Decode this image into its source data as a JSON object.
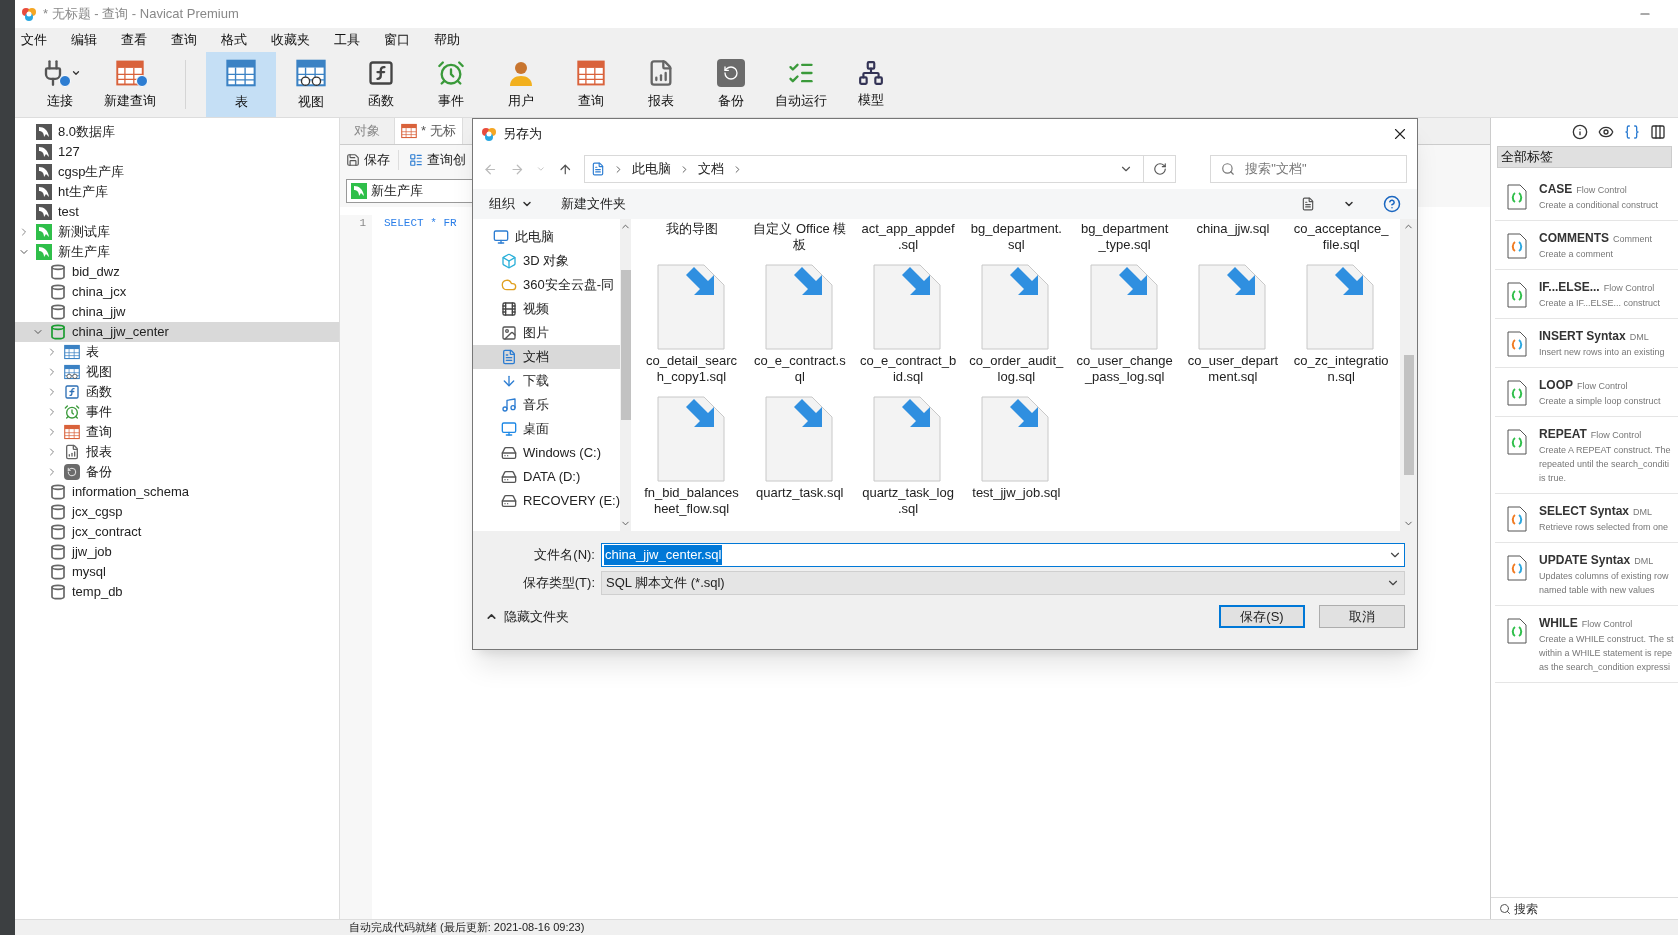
{
  "window": {
    "title": "* 无标题 - 查询 - Navicat Premium"
  },
  "menu": [
    "文件",
    "编辑",
    "查看",
    "查询",
    "格式",
    "收藏夹",
    "工具",
    "窗口",
    "帮助"
  ],
  "toolbar": [
    {
      "label": "连接",
      "kind": "connect",
      "selected": false,
      "dropdown": true
    },
    {
      "label": "新建查询",
      "kind": "new_query",
      "selected": false,
      "dropdown": false
    },
    {
      "label": "表",
      "kind": "table",
      "selected": true,
      "dropdown": false
    },
    {
      "label": "视图",
      "kind": "view",
      "selected": false,
      "dropdown": false
    },
    {
      "label": "函数",
      "kind": "function",
      "selected": false,
      "dropdown": false
    },
    {
      "label": "事件",
      "kind": "event",
      "selected": false,
      "dropdown": false
    },
    {
      "label": "用户",
      "kind": "user",
      "selected": false,
      "dropdown": false
    },
    {
      "label": "查询",
      "kind": "query",
      "selected": false,
      "dropdown": false
    },
    {
      "label": "报表",
      "kind": "report",
      "selected": false,
      "dropdown": false
    },
    {
      "label": "备份",
      "kind": "backup",
      "selected": false,
      "dropdown": false
    },
    {
      "label": "自动运行",
      "kind": "autorun",
      "selected": false,
      "dropdown": false
    },
    {
      "label": "模型",
      "kind": "model",
      "selected": false,
      "dropdown": false
    }
  ],
  "tree": [
    {
      "label": "8.0数据库",
      "kind": "connection",
      "selected": false
    },
    {
      "label": "127",
      "kind": "connection",
      "selected": false
    },
    {
      "label": "cgsp生产库",
      "kind": "connection",
      "selected": false
    },
    {
      "label": "ht生产库",
      "kind": "connection",
      "selected": false
    },
    {
      "label": "test",
      "kind": "connection",
      "selected": false
    },
    {
      "label": "新测试库",
      "kind": "connection_open",
      "expanded": false,
      "selected": false
    },
    {
      "label": "新生产库",
      "kind": "connection_open",
      "expanded": true,
      "selected": false,
      "children": [
        {
          "label": "bid_dwz",
          "kind": "database",
          "selected": false
        },
        {
          "label": "china_jcx",
          "kind": "database",
          "selected": false
        },
        {
          "label": "china_jjw",
          "kind": "database",
          "selected": false
        },
        {
          "label": "china_jjw_center",
          "kind": "database_open",
          "expanded": true,
          "selected": true,
          "children": [
            {
              "label": "表",
              "kind": "table",
              "expanded": false,
              "selected": false
            },
            {
              "label": "视图",
              "kind": "view",
              "expanded": false,
              "selected": false
            },
            {
              "label": "函数",
              "kind": "function",
              "expanded": false,
              "selected": false
            },
            {
              "label": "事件",
              "kind": "event",
              "expanded": false,
              "selected": false
            },
            {
              "label": "查询",
              "kind": "query",
              "expanded": false,
              "selected": false
            },
            {
              "label": "报表",
              "kind": "report",
              "expanded": false,
              "selected": false
            },
            {
              "label": "备份",
              "kind": "backup",
              "expanded": false,
              "selected": false
            }
          ]
        },
        {
          "label": "information_schema",
          "kind": "database",
          "selected": false
        },
        {
          "label": "jcx_cgsp",
          "kind": "database",
          "selected": false
        },
        {
          "label": "jcx_contract",
          "kind": "database",
          "selected": false
        },
        {
          "label": "jjw_job",
          "kind": "database",
          "selected": false
        },
        {
          "label": "mysql",
          "kind": "database",
          "selected": false
        },
        {
          "label": "temp_db",
          "kind": "database",
          "selected": false
        }
      ]
    }
  ],
  "editor": {
    "tabs": [
      {
        "label": "对象",
        "kind": "plain",
        "selected": false
      },
      {
        "label": "* 无标",
        "kind": "query",
        "selected": true
      }
    ],
    "buttons": [
      {
        "label": "保存",
        "kind": "save"
      },
      {
        "label": "查询创",
        "kind": "builder"
      }
    ],
    "connection": "新生产库",
    "lines": [
      {
        "number": "1",
        "code": "SELECT * FR"
      }
    ]
  },
  "snippets": {
    "filter": "全部标签",
    "items": [
      {
        "title": "CASE",
        "category": "Flow Control",
        "kind": "flow",
        "description": [
          "Create a conditional construct"
        ]
      },
      {
        "title": "COMMENTS",
        "category": "Comment",
        "kind": "statement",
        "description": [
          "Create a comment"
        ]
      },
      {
        "title": "IF...ELSE...",
        "category": "Flow Control",
        "kind": "flow",
        "description": [
          "Create a IF...ELSE... construct"
        ]
      },
      {
        "title": "INSERT Syntax",
        "category": "DML",
        "kind": "statement",
        "description": [
          "Insert new rows into an existing"
        ]
      },
      {
        "title": "LOOP",
        "category": "Flow Control",
        "kind": "flow",
        "description": [
          "Create a simple loop construct"
        ]
      },
      {
        "title": "REPEAT",
        "category": "Flow Control",
        "kind": "flow",
        "description": [
          "Create A REPEAT construct. The",
          "repeated until the search_conditi",
          "is true."
        ]
      },
      {
        "title": "SELECT Syntax",
        "category": "DML",
        "kind": "statement",
        "description": [
          "Retrieve rows selected from one"
        ]
      },
      {
        "title": "UPDATE Syntax",
        "category": "DML",
        "kind": "statement",
        "description": [
          "Updates columns of existing row",
          "named table with new values"
        ]
      },
      {
        "title": "WHILE",
        "category": "Flow Control",
        "kind": "flow",
        "description": [
          "Create a WHILE construct. The st",
          "within a WHILE statement is repe",
          "as the search_condition expressi"
        ]
      }
    ],
    "search": "搜索"
  },
  "status_bar": "自动完成代码就绪 (最后更新: 2021-08-16 09:23)",
  "dialog": {
    "title": "另存为",
    "breadcrumb": [
      "此电脑",
      "文档"
    ],
    "search_placeholder": "搜索\"文档\"",
    "commands": [
      {
        "label": "组织",
        "dropdown": true
      },
      {
        "label": "新建文件夹",
        "dropdown": false
      }
    ],
    "places": [
      {
        "label": "此电脑",
        "kind": "pc",
        "selected": false
      },
      {
        "label": "3D 对象",
        "kind": "objects3d",
        "selected": false
      },
      {
        "label": "360安全云盘-同",
        "kind": "cloud",
        "selected": false
      },
      {
        "label": "视频",
        "kind": "video",
        "selected": false
      },
      {
        "label": "图片",
        "kind": "pictures",
        "selected": false
      },
      {
        "label": "文档",
        "kind": "documents",
        "selected": true
      },
      {
        "label": "下载",
        "kind": "downloads",
        "selected": false
      },
      {
        "label": "音乐",
        "kind": "music",
        "selected": false
      },
      {
        "label": "桌面",
        "kind": "desktop",
        "selected": false
      },
      {
        "label": "Windows (C:)",
        "kind": "drive",
        "selected": false
      },
      {
        "label": "DATA (D:)",
        "kind": "drive",
        "selected": false
      },
      {
        "label": "RECOVERY (E:)",
        "kind": "drive",
        "selected": false
      }
    ],
    "files": [
      {
        "lines": [
          "我的导图"
        ],
        "kind": "cut"
      },
      {
        "lines": [
          "自定义 Office 模",
          "板"
        ],
        "kind": "cut"
      },
      {
        "lines": [
          "act_app_appdef",
          ".sql"
        ],
        "kind": "cut"
      },
      {
        "lines": [
          "bg_department.",
          "sql"
        ],
        "kind": "cut"
      },
      {
        "lines": [
          "bg_department",
          "_type.sql"
        ],
        "kind": "cut"
      },
      {
        "lines": [
          "china_jjw.sql"
        ],
        "kind": "cut"
      },
      {
        "lines": [
          "co_acceptance_",
          "file.sql"
        ],
        "kind": "cut"
      },
      {
        "lines": [
          "co_detail_searc",
          "h_copy1.sql"
        ],
        "kind": "file"
      },
      {
        "lines": [
          "co_e_contract.s",
          "ql"
        ],
        "kind": "file"
      },
      {
        "lines": [
          "co_e_contract_b",
          "id.sql"
        ],
        "kind": "file"
      },
      {
        "lines": [
          "co_order_audit_",
          "log.sql"
        ],
        "kind": "file"
      },
      {
        "lines": [
          "co_user_change",
          "_pass_log.sql"
        ],
        "kind": "file"
      },
      {
        "lines": [
          "co_user_depart",
          "ment.sql"
        ],
        "kind": "file"
      },
      {
        "lines": [
          "co_zc_integratio",
          "n.sql"
        ],
        "kind": "file"
      },
      {
        "lines": [
          "fn_bid_balances",
          "heet_flow.sql"
        ],
        "kind": "file"
      },
      {
        "lines": [
          "quartz_task.sql"
        ],
        "kind": "file"
      },
      {
        "lines": [
          "quartz_task_log",
          ".sql"
        ],
        "kind": "file"
      },
      {
        "lines": [
          "test_jjw_job.sql"
        ],
        "kind": "file"
      }
    ],
    "filename_label": "文件名(N):",
    "filename": {
      "value": "china_jjw_center.sql",
      "text_selected": true
    },
    "type_label": "保存类型(T):",
    "type": "SQL 脚本文件 (*.sql)",
    "hide_folders": "隐藏文件夹",
    "buttons": [
      {
        "label": "保存(S)",
        "default": true
      },
      {
        "label": "取消",
        "default": false
      }
    ]
  }
}
